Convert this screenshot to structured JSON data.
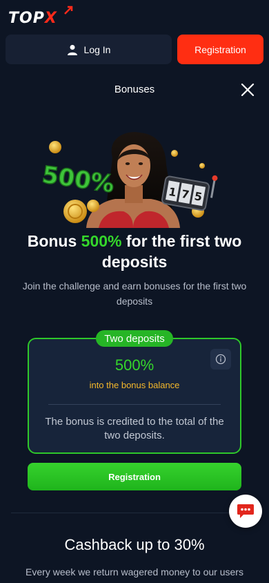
{
  "header": {
    "logo": {
      "main": "TOP",
      "accent": "X"
    },
    "login_label": "Log In",
    "registration_label": "Registration"
  },
  "modal": {
    "title": "Bonuses",
    "hero": {
      "badge_text": "500%",
      "slot_digits": [
        "1",
        "7",
        "5"
      ]
    },
    "headline": {
      "before": "Bonus ",
      "accent": "500%",
      "after": " for the first two deposits"
    },
    "subtitle": "Join the challenge and earn bonuses for the first two deposits",
    "card": {
      "badge": "Two deposits",
      "value": "500%",
      "caption": "into the bonus balance",
      "note": "The bonus is credited to the total of the two deposits."
    },
    "registration_label": "Registration"
  },
  "cashback": {
    "title": "Cashback up to 30%",
    "text": "Every week we return wagered money to our users"
  },
  "colors": {
    "background": "#0d1524",
    "brand_red": "#ff2e12",
    "accent_green": "#35d62b",
    "caption_yellow": "#f5b82b"
  }
}
